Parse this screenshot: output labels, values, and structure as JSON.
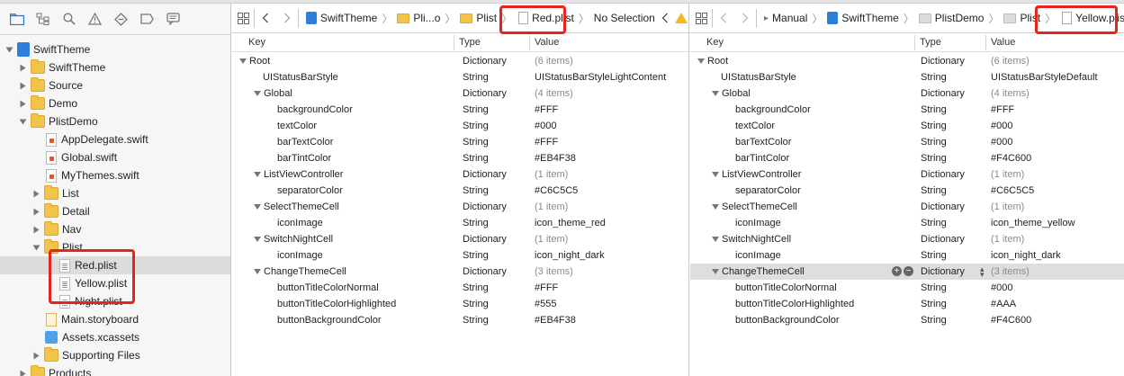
{
  "window": {
    "title_partial": ""
  },
  "navigator": {
    "toolbar_icons": [
      "folder-icon",
      "hierarchy-icon",
      "search-icon",
      "warning-icon",
      "breakpoint-icon",
      "list-icon",
      "comment-icon"
    ],
    "items": [
      {
        "label": "SwiftTheme",
        "kind": "project",
        "depth": 0,
        "disclosure": "open"
      },
      {
        "label": "SwiftTheme",
        "kind": "folder",
        "depth": 1,
        "disclosure": "closed"
      },
      {
        "label": "Source",
        "kind": "folder",
        "depth": 1,
        "disclosure": "closed"
      },
      {
        "label": "Demo",
        "kind": "folder",
        "depth": 1,
        "disclosure": "closed"
      },
      {
        "label": "PlistDemo",
        "kind": "folder",
        "depth": 1,
        "disclosure": "open"
      },
      {
        "label": "AppDelegate.swift",
        "kind": "swift",
        "depth": 2,
        "disclosure": "none"
      },
      {
        "label": "Global.swift",
        "kind": "swift",
        "depth": 2,
        "disclosure": "none"
      },
      {
        "label": "MyThemes.swift",
        "kind": "swift",
        "depth": 2,
        "disclosure": "none"
      },
      {
        "label": "List",
        "kind": "folder",
        "depth": 2,
        "disclosure": "closed"
      },
      {
        "label": "Detail",
        "kind": "folder",
        "depth": 2,
        "disclosure": "closed"
      },
      {
        "label": "Nav",
        "kind": "folder",
        "depth": 2,
        "disclosure": "closed"
      },
      {
        "label": "Plist",
        "kind": "folder",
        "depth": 2,
        "disclosure": "open"
      },
      {
        "label": "Red.plist",
        "kind": "plist",
        "depth": 3,
        "disclosure": "none",
        "selected": true
      },
      {
        "label": "Yellow.plist",
        "kind": "plist",
        "depth": 3,
        "disclosure": "none"
      },
      {
        "label": "Night.plist",
        "kind": "plist",
        "depth": 3,
        "disclosure": "none"
      },
      {
        "label": "Main.storyboard",
        "kind": "storyboard",
        "depth": 2,
        "disclosure": "none"
      },
      {
        "label": "Assets.xcassets",
        "kind": "xcassets",
        "depth": 2,
        "disclosure": "none"
      },
      {
        "label": "Supporting Files",
        "kind": "folder",
        "depth": 2,
        "disclosure": "closed"
      },
      {
        "label": "Products",
        "kind": "folder",
        "depth": 1,
        "disclosure": "closed"
      }
    ]
  },
  "left_editor": {
    "breadcrumbs": [
      "SwiftTheme",
      "Pli...o",
      "Plist",
      "Red.plist",
      "No Selection"
    ],
    "columns": {
      "key": "Key",
      "type": "Type",
      "value": "Value"
    },
    "rows": [
      {
        "key": "Root",
        "type": "Dictionary",
        "value": "(6 items)",
        "depth": 0,
        "expanded": true,
        "dim": true
      },
      {
        "key": "UIStatusBarStyle",
        "type": "String",
        "value": "UIStatusBarStyleLightContent",
        "depth": 1,
        "expanded": null,
        "dim": false
      },
      {
        "key": "Global",
        "type": "Dictionary",
        "value": "(4 items)",
        "depth": 1,
        "expanded": true,
        "dim": true
      },
      {
        "key": "backgroundColor",
        "type": "String",
        "value": "#FFF",
        "depth": 2,
        "expanded": null,
        "dim": false
      },
      {
        "key": "textColor",
        "type": "String",
        "value": "#000",
        "depth": 2,
        "expanded": null,
        "dim": false
      },
      {
        "key": "barTextColor",
        "type": "String",
        "value": "#FFF",
        "depth": 2,
        "expanded": null,
        "dim": false
      },
      {
        "key": "barTintColor",
        "type": "String",
        "value": "#EB4F38",
        "depth": 2,
        "expanded": null,
        "dim": false
      },
      {
        "key": "ListViewController",
        "type": "Dictionary",
        "value": "(1 item)",
        "depth": 1,
        "expanded": true,
        "dim": true
      },
      {
        "key": "separatorColor",
        "type": "String",
        "value": "#C6C5C5",
        "depth": 2,
        "expanded": null,
        "dim": false
      },
      {
        "key": "SelectThemeCell",
        "type": "Dictionary",
        "value": "(1 item)",
        "depth": 1,
        "expanded": true,
        "dim": true
      },
      {
        "key": "iconImage",
        "type": "String",
        "value": "icon_theme_red",
        "depth": 2,
        "expanded": null,
        "dim": false
      },
      {
        "key": "SwitchNightCell",
        "type": "Dictionary",
        "value": "(1 item)",
        "depth": 1,
        "expanded": true,
        "dim": true
      },
      {
        "key": "iconImage",
        "type": "String",
        "value": "icon_night_dark",
        "depth": 2,
        "expanded": null,
        "dim": false
      },
      {
        "key": "ChangeThemeCell",
        "type": "Dictionary",
        "value": "(3 items)",
        "depth": 1,
        "expanded": true,
        "dim": true
      },
      {
        "key": "buttonTitleColorNormal",
        "type": "String",
        "value": "#FFF",
        "depth": 2,
        "expanded": null,
        "dim": false
      },
      {
        "key": "buttonTitleColorHighlighted",
        "type": "String",
        "value": "#555",
        "depth": 2,
        "expanded": null,
        "dim": false
      },
      {
        "key": "buttonBackgroundColor",
        "type": "String",
        "value": "#EB4F38",
        "depth": 2,
        "expanded": null,
        "dim": false
      }
    ]
  },
  "right_editor": {
    "breadcrumbs": [
      "Manual",
      "SwiftTheme",
      "PlistDemo",
      "Plist",
      "Yellow.plist"
    ],
    "columns": {
      "key": "Key",
      "type": "Type",
      "value": "Value"
    },
    "rows": [
      {
        "key": "Root",
        "type": "Dictionary",
        "value": "(6 items)",
        "depth": 0,
        "expanded": true,
        "dim": true
      },
      {
        "key": "UIStatusBarStyle",
        "type": "String",
        "value": "UIStatusBarStyleDefault",
        "depth": 1,
        "expanded": null,
        "dim": false
      },
      {
        "key": "Global",
        "type": "Dictionary",
        "value": "(4 items)",
        "depth": 1,
        "expanded": true,
        "dim": true
      },
      {
        "key": "backgroundColor",
        "type": "String",
        "value": "#FFF",
        "depth": 2,
        "expanded": null,
        "dim": false
      },
      {
        "key": "textColor",
        "type": "String",
        "value": "#000",
        "depth": 2,
        "expanded": null,
        "dim": false
      },
      {
        "key": "barTextColor",
        "type": "String",
        "value": "#000",
        "depth": 2,
        "expanded": null,
        "dim": false
      },
      {
        "key": "barTintColor",
        "type": "String",
        "value": "#F4C600",
        "depth": 2,
        "expanded": null,
        "dim": false
      },
      {
        "key": "ListViewController",
        "type": "Dictionary",
        "value": "(1 item)",
        "depth": 1,
        "expanded": true,
        "dim": true
      },
      {
        "key": "separatorColor",
        "type": "String",
        "value": "#C6C5C5",
        "depth": 2,
        "expanded": null,
        "dim": false
      },
      {
        "key": "SelectThemeCell",
        "type": "Dictionary",
        "value": "(1 item)",
        "depth": 1,
        "expanded": true,
        "dim": true
      },
      {
        "key": "iconImage",
        "type": "String",
        "value": "icon_theme_yellow",
        "depth": 2,
        "expanded": null,
        "dim": false
      },
      {
        "key": "SwitchNightCell",
        "type": "Dictionary",
        "value": "(1 item)",
        "depth": 1,
        "expanded": true,
        "dim": true
      },
      {
        "key": "iconImage",
        "type": "String",
        "value": "icon_night_dark",
        "depth": 2,
        "expanded": null,
        "dim": false
      },
      {
        "key": "ChangeThemeCell",
        "type": "Dictionary",
        "value": "(3 items)",
        "depth": 1,
        "expanded": true,
        "dim": true,
        "selected": true
      },
      {
        "key": "buttonTitleColorNormal",
        "type": "String",
        "value": "#000",
        "depth": 2,
        "expanded": null,
        "dim": false
      },
      {
        "key": "buttonTitleColorHighlighted",
        "type": "String",
        "value": "#AAA",
        "depth": 2,
        "expanded": null,
        "dim": false
      },
      {
        "key": "buttonBackgroundColor",
        "type": "String",
        "value": "#F4C600",
        "depth": 2,
        "expanded": null,
        "dim": false
      }
    ]
  },
  "colors": {
    "highlight_red": "#e5241d",
    "folder_yellow": "#f2c44a",
    "project_blue": "#2d7fd9"
  }
}
